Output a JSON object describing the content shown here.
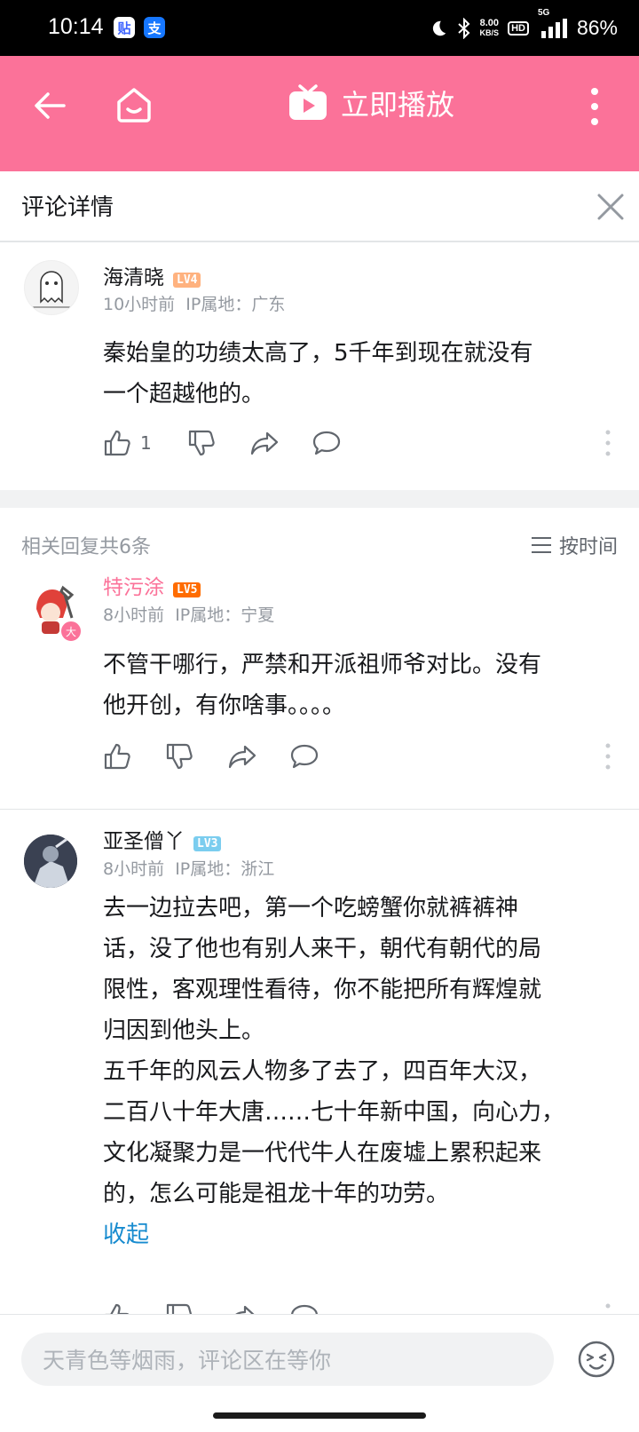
{
  "status_bar": {
    "time": "10:14",
    "app_icons": [
      "tieba-icon",
      "alipay-icon"
    ],
    "app_glyphs": [
      "贴",
      "支"
    ],
    "net_speed_value": "8.00",
    "net_speed_unit": "KB/S",
    "hd_label": "HD",
    "signal_label": "5G",
    "battery": "86%"
  },
  "topbar": {
    "play_label": "立即播放",
    "bg_color": "#fb7299"
  },
  "sheet": {
    "title": "评论详情"
  },
  "root_comment": {
    "username": "海清晓",
    "level": "LV4",
    "level_color": "#ffb27f",
    "time": "10小时前",
    "ip": "IP属地：广东",
    "content": [
      "秦始皇的功绩太高了，5千年到现在就没有",
      "一个超越他的。"
    ],
    "likes": "1"
  },
  "replies_header": {
    "count_text": "相关回复共6条",
    "sort_label": "按时间"
  },
  "replies": [
    {
      "username": "特污涂",
      "username_color": "#fb7299",
      "level": "LV5",
      "level_color": "#ff6c00",
      "badge": "大",
      "time": "8小时前",
      "ip": "IP属地：宁夏",
      "content": [
        "不管干哪行，严禁和开派祖师爷对比。没有",
        "他开创，有你啥事。。。。"
      ]
    },
    {
      "username": "亚圣僧丫",
      "username_color": "#18191c",
      "level": "LV3",
      "level_color": "#7bcdef",
      "time": "8小时前",
      "ip": "IP属地：浙江",
      "content": [
        "去一边拉去吧，第一个吃螃蟹你就裤裤神",
        "话，没了他也有别人来干，朝代有朝代的局",
        "限性，客观理性看待，你不能把所有辉煌就",
        "归因到他头上。",
        "五千年的风云人物多了去了，四百年大汉，",
        "二百八十年大唐……七十年新中国，向心力，",
        "文化凝聚力是一代代牛人在废墟上累积起来",
        "的，怎么可能是祖龙十年的功劳。"
      ],
      "collapse_label": "收起",
      "collapse_color": "#178bcf"
    }
  ],
  "bottom_bar": {
    "placeholder": "天青色等烟雨，评论区在等你"
  }
}
